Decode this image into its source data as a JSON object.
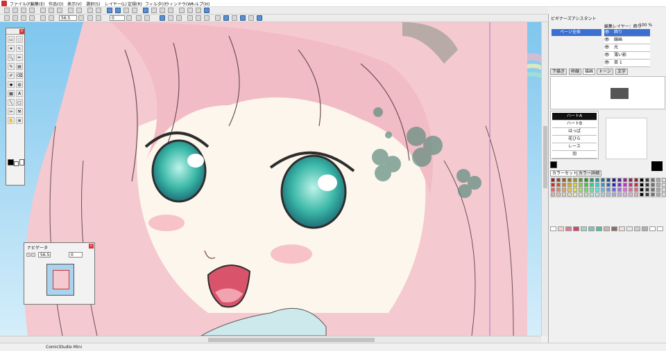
{
  "menu": {
    "items": [
      "ファイル(F)",
      "編集(E)",
      "作品(O)",
      "表示(V)",
      "選択(S)",
      "レイヤー(L)",
      "定規(R)",
      "フィルタ(I)",
      "ウィンドウ(W)",
      "ヘルプ(H)"
    ]
  },
  "toolbar": {
    "zoom_value": "56.5",
    "rotation_value": "0"
  },
  "toolbox": {
    "tools": [
      {
        "label": "▭",
        "icon": "rect-select-icon"
      },
      {
        "label": "◌",
        "icon": "lasso-icon"
      },
      {
        "label": "✦",
        "icon": "wand-icon"
      },
      {
        "label": "↖",
        "icon": "move-icon"
      },
      {
        "label": "🔍",
        "icon": "zoom-icon"
      },
      {
        "label": "✏",
        "icon": "pen-icon"
      },
      {
        "label": "✎",
        "icon": "pencil-icon"
      },
      {
        "label": "▤",
        "icon": "marker-icon"
      },
      {
        "label": "✐",
        "icon": "brush-icon"
      },
      {
        "label": "⌫",
        "icon": "eraser-icon"
      },
      {
        "label": "◆",
        "icon": "fill-icon"
      },
      {
        "label": "◍",
        "icon": "tone-icon"
      },
      {
        "label": "▦",
        "icon": "gradient-icon"
      },
      {
        "label": "A",
        "icon": "text-icon"
      },
      {
        "label": "╲",
        "icon": "line-icon"
      },
      {
        "label": "□",
        "icon": "shape-icon"
      },
      {
        "label": "✂",
        "icon": "cut-icon"
      },
      {
        "label": "⚒",
        "icon": "frame-icon"
      },
      {
        "label": "✋",
        "icon": "hand-icon"
      },
      {
        "label": "⊕",
        "icon": "zoom2-icon"
      }
    ]
  },
  "navigator": {
    "title": "ナビゲータ",
    "zoom_value": "56.5",
    "rotation_value": "0"
  },
  "assistant": {
    "title": "ビギナーズアシスタント",
    "edit_layer_label": "編集レイヤー：飾り",
    "edit_layer_opacity": "100 %",
    "page_item": "ページ全体",
    "layers": [
      "飾り",
      "線画",
      "光",
      "薄い影",
      "目 1"
    ],
    "tabs": [
      "下描き",
      "枠線",
      "描画",
      "トーン",
      "文字"
    ],
    "active_tab": 2,
    "brushes": [
      "ハートA",
      "ハートB",
      "はっぱ",
      "花びら",
      "レース",
      "羽"
    ],
    "selected_brush": 0,
    "color_tabs": [
      "カラーセット",
      "カラー詳細"
    ]
  },
  "status": {
    "app_name": "ComicStudio Mini"
  },
  "colors": {
    "palette_row": [
      "#ffffff",
      "#f5d0c8",
      "#e07a9a",
      "#c94a6a",
      "#9dd6c9",
      "#7cc7b8",
      "#5fb9a8",
      "#c9b7b0",
      "#8a6f66",
      "#f0e0e0",
      "#e8e8e8",
      "#d0d0d0",
      "#b0b0b0",
      "#ffffff",
      "#ffffff"
    ],
    "main_color": "#000000",
    "accent": "#3b6fd0"
  }
}
